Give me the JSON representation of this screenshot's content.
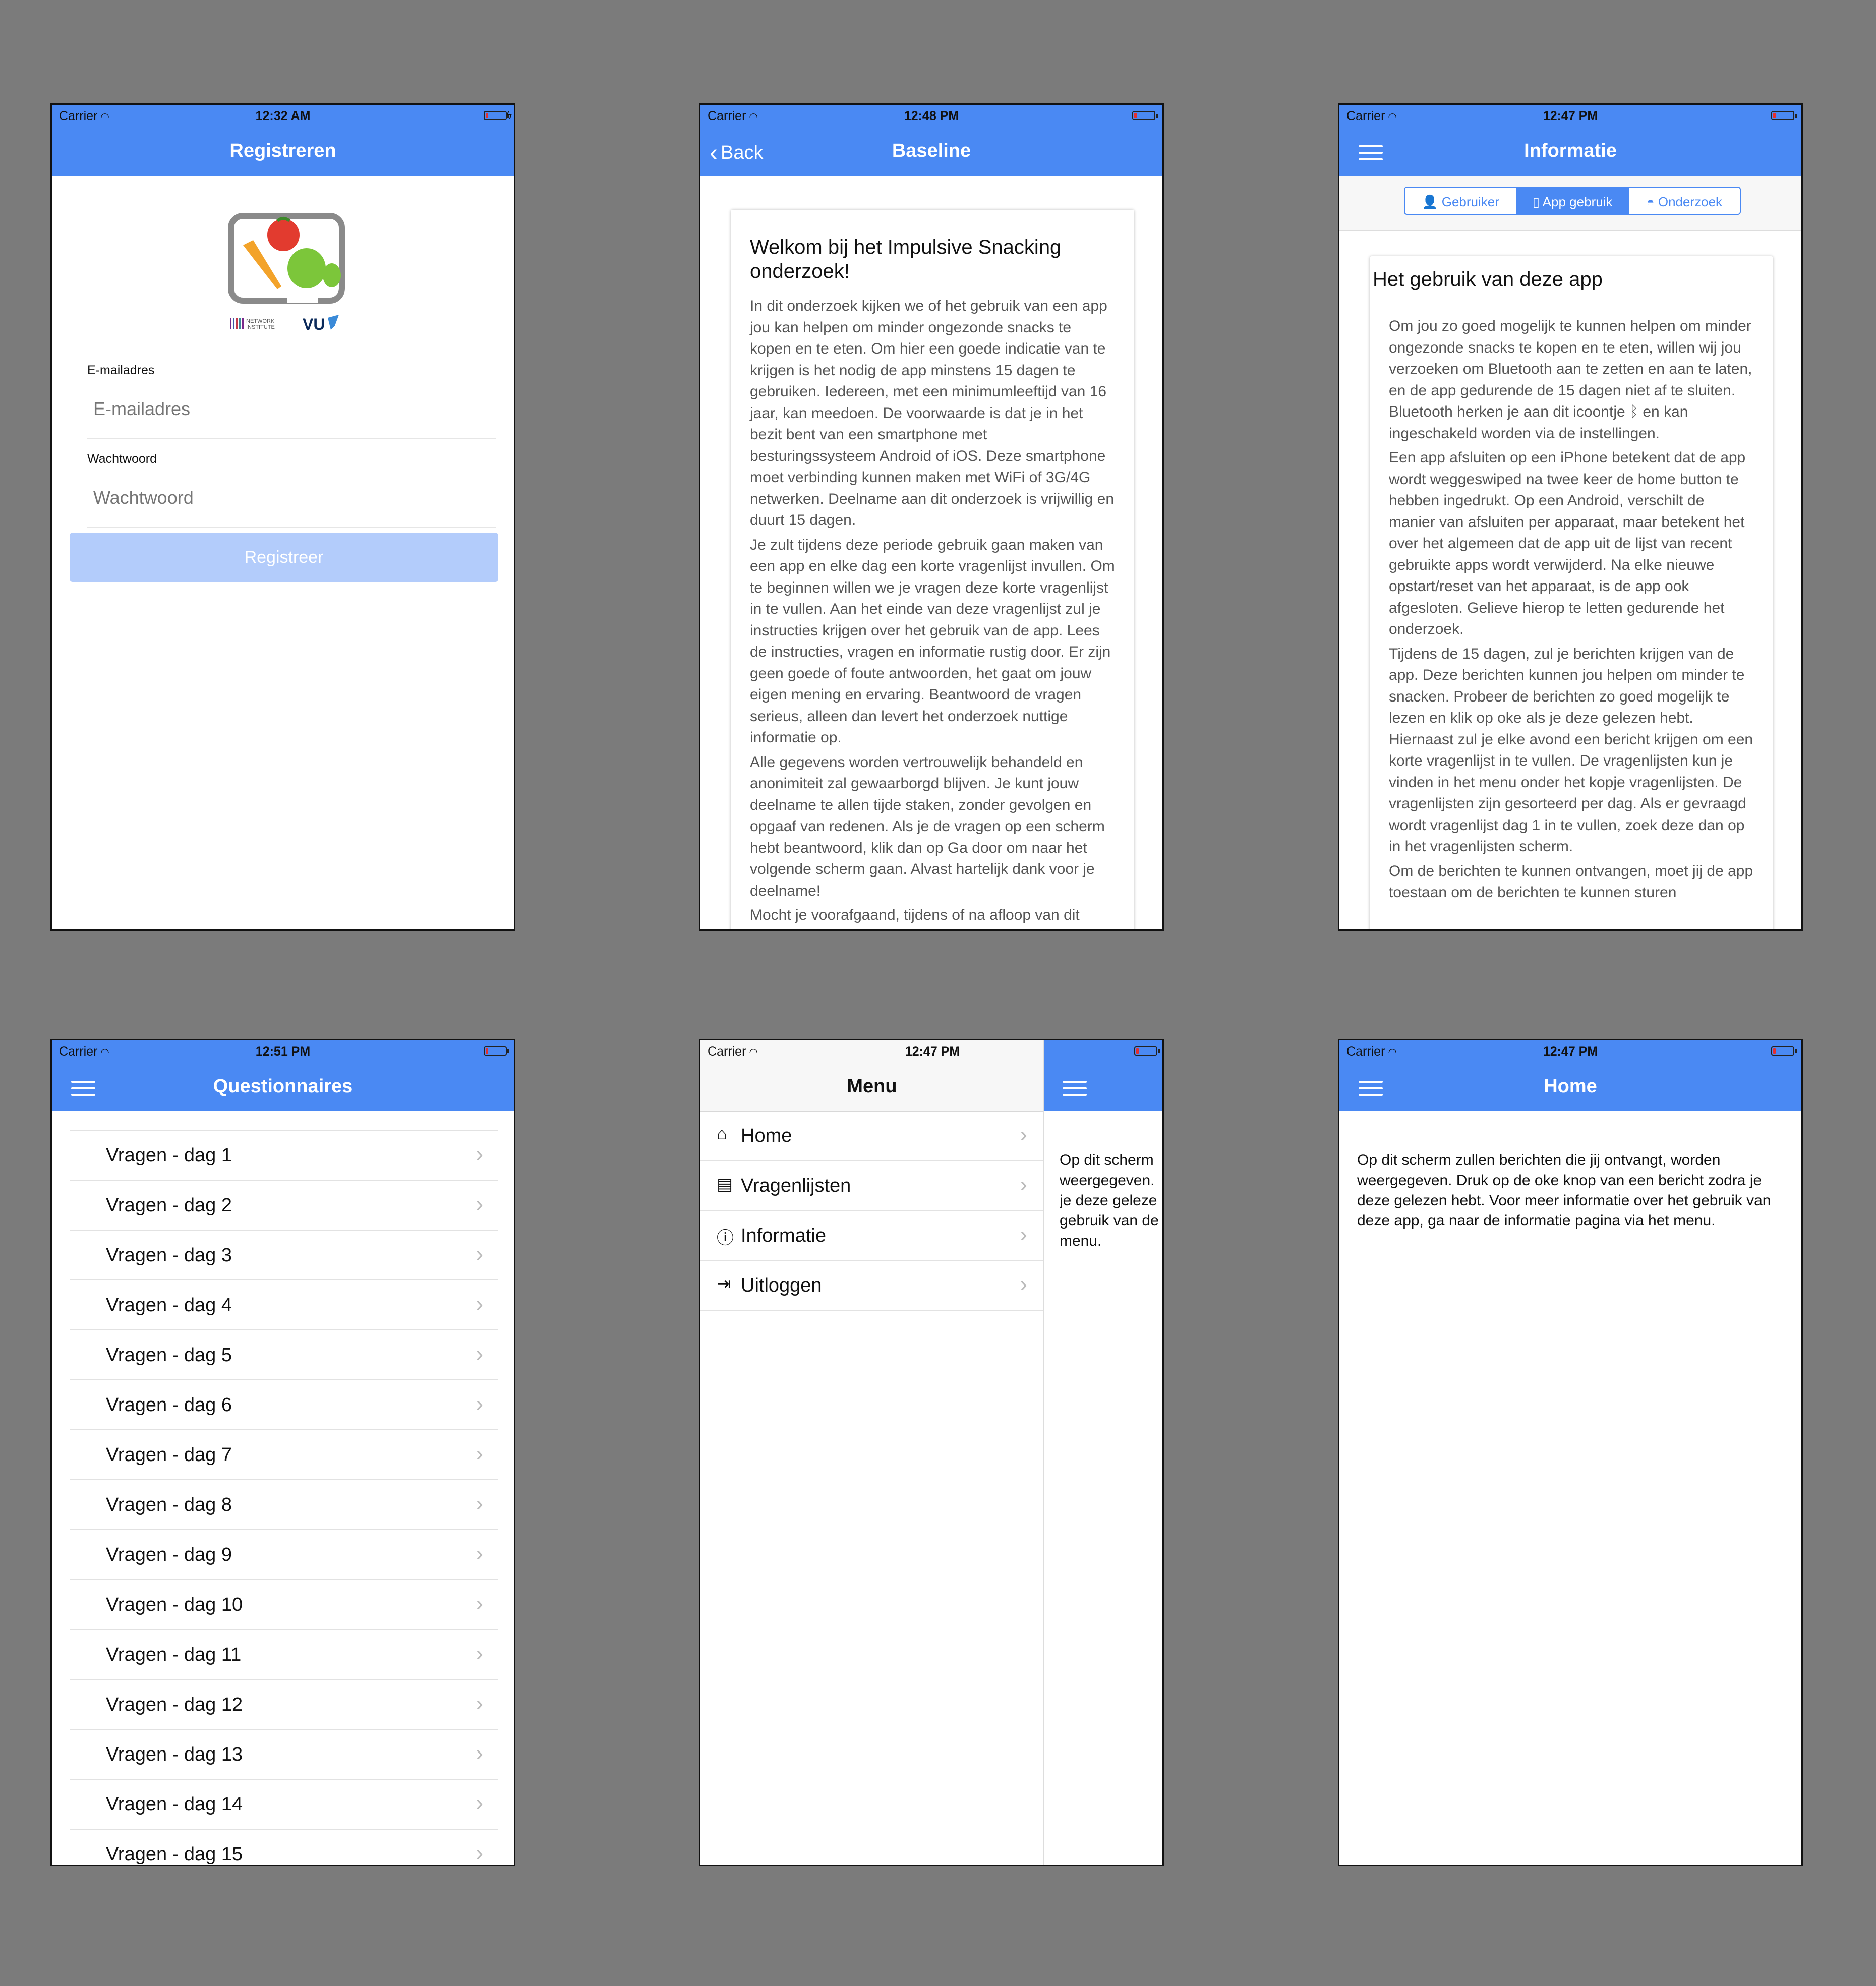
{
  "theme": {
    "accent": "#4a89f3",
    "disabled_button": "#b3ccfb",
    "background": "#7b7b7b"
  },
  "screens": {
    "register": {
      "status": {
        "carrier": "Carrier",
        "time": "12:32 AM"
      },
      "title": "Registreren",
      "logo_lettering": [
        "NETWORK INSTITUTE",
        "VU"
      ],
      "email_label": "E-mailadres",
      "email_placeholder": "E-mailadres",
      "password_label": "Wachtwoord",
      "password_placeholder": "Wachtwoord",
      "button": "Registreer"
    },
    "baseline": {
      "status": {
        "carrier": "Carrier",
        "time": "12:48 PM"
      },
      "back": "Back",
      "title": "Baseline",
      "card_title": "Welkom bij het Impulsive Snacking onderzoek!",
      "paragraphs": [
        "In dit onderzoek kijken we of het gebruik van een app jou kan helpen om minder ongezonde snacks te kopen en te eten. Om hier een goede indicatie van te krijgen is het nodig de app minstens 15 dagen te gebruiken. Iedereen, met een minimumleeftijd van 16 jaar, kan meedoen. De voorwaarde is dat je in het bezit bent van een smartphone met besturingssysteem Android of iOS. Deze smartphone moet verbinding kunnen maken met WiFi of 3G/4G netwerken. Deelname aan dit onderzoek is vrijwillig en duurt 15 dagen.",
        "Je zult tijdens deze periode gebruik gaan maken van een app en elke dag een korte vragenlijst invullen. Om te beginnen willen we je vragen deze korte vragenlijst in te vullen. Aan het einde van deze vragenlijst zul je instructies krijgen over het gebruik van de app. Lees de instructies, vragen en informatie rustig door. Er zijn geen goede of foute antwoorden, het gaat om jouw eigen mening en ervaring. Beantwoord de vragen serieus, alleen dan levert het onderzoek nuttige informatie op.",
        "Alle gegevens worden vertrouwelijk behandeld en anonimiteit zal gewaarborgd blijven. Je kunt jouw deelname te allen tijde staken, zonder gevolgen en opgaaf van redenen. Als je de vragen op een scherm hebt beantwoord, klik dan op Ga door om naar het volgende scherm gaan. Alvast hartelijk dank voor je deelname!",
        "Mocht je voorafgaand, tijdens of na afloop van dit onderzoek vragen hebben met betrekking tot dit"
      ]
    },
    "info": {
      "status": {
        "carrier": "Carrier",
        "time": "12:47 PM"
      },
      "title": "Informatie",
      "segments": [
        "Gebruiker",
        "App gebruik",
        "Onderzoek"
      ],
      "active_segment": "App gebruik",
      "card_title": "Het gebruik van deze app",
      "paragraphs": [
        "Om jou zo goed mogelijk te kunnen helpen om minder ongezonde snacks te kopen en te eten, willen wij jou verzoeken om Bluetooth aan te zetten en aan te laten, en de app gedurende de 15 dagen niet af te sluiten. Bluetooth herken je aan dit icoontje ᛒ en kan ingeschakeld worden via de instellingen.",
        "Een app afsluiten op een iPhone betekent dat de app wordt weggeswiped na twee keer de home button te hebben ingedrukt. Op een Android, verschilt de manier van afsluiten per apparaat, maar betekent het over het algemeen dat de app uit de lijst van recent gebruikte apps wordt verwijderd. Na elke nieuwe opstart/reset van het apparaat, is de app ook afgesloten. Gelieve hierop te letten gedurende het onderzoek.",
        "Tijdens de 15 dagen, zul je berichten krijgen van de app. Deze berichten kunnen jou helpen om minder te snacken. Probeer de berichten zo goed mogelijk te lezen en klik op oke als je deze gelezen hebt. Hiernaast zul je elke avond een bericht krijgen om een korte vragenlijst in te vullen. De vragenlijsten kun je vinden in het menu onder het kopje vragenlijsten. De vragenlijsten zijn gesorteerd per dag. Als er gevraagd wordt vragenlijst dag 1 in te vullen, zoek deze dan op in het vragenlijsten scherm.",
        "Om de berichten te kunnen ontvangen, moet jij de app toestaan om de berichten te kunnen sturen"
      ]
    },
    "questionnaires": {
      "status": {
        "carrier": "Carrier",
        "time": "12:51 PM"
      },
      "title": "Questionnaires",
      "items": [
        "Vragen - dag 1",
        "Vragen - dag 2",
        "Vragen - dag 3",
        "Vragen - dag 4",
        "Vragen - dag 5",
        "Vragen - dag 6",
        "Vragen - dag 7",
        "Vragen - dag 8",
        "Vragen - dag 9",
        "Vragen - dag 10",
        "Vragen - dag 11",
        "Vragen - dag 12",
        "Vragen - dag 13",
        "Vragen - dag 14",
        "Vragen - dag 15"
      ]
    },
    "menu": {
      "status": {
        "carrier": "Carrier",
        "time": "12:47 PM"
      },
      "title": "Menu",
      "items": [
        {
          "label": "Home",
          "icon": "home-icon"
        },
        {
          "label": "Vragenlijsten",
          "icon": "book-icon"
        },
        {
          "label": "Informatie",
          "icon": "info-icon"
        },
        {
          "label": "Uitloggen",
          "icon": "logout-icon"
        }
      ],
      "peek_lines": [
        "Op dit scherm",
        "weergegeven.",
        "je deze geleze",
        "gebruik van de",
        "menu."
      ]
    },
    "home": {
      "status": {
        "carrier": "Carrier",
        "time": "12:47 PM"
      },
      "title": "Home",
      "text": "Op dit scherm zullen berichten die jij ontvangt, worden weergegeven. Druk op de oke knop van een bericht zodra je deze gelezen hebt. Voor meer informatie over het gebruik van deze app, ga naar de informatie pagina via het menu."
    }
  }
}
